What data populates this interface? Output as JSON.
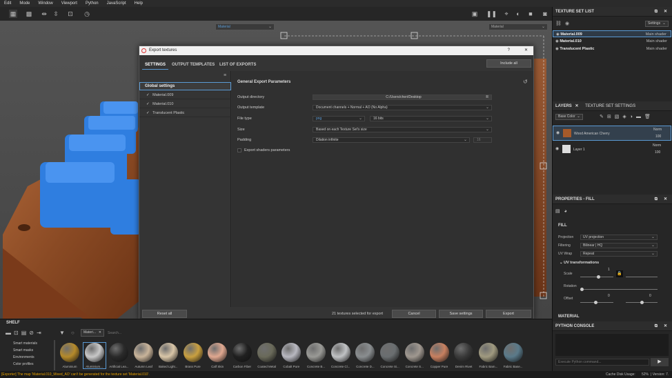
{
  "menu": [
    "Edit",
    "Mode",
    "Window",
    "Viewport",
    "Python",
    "JavaScript",
    "Help"
  ],
  "viewport": {
    "left_select": "Material",
    "right_select": "Material"
  },
  "dialog": {
    "title": "Export textures",
    "help": "?",
    "close": "✕",
    "tabs": [
      "SETTINGS",
      "OUTPUT TEMPLATES",
      "LIST OF EXPORTS"
    ],
    "include_all": "Include all",
    "global_settings": "Global settings",
    "texture_sets": [
      "Material.009",
      "Material.010",
      "Translucent Plastic"
    ],
    "section_title": "General Export Parameters",
    "rows": {
      "output_directory": {
        "label": "Output directory",
        "value": "C:/Users/cheri/Desktop",
        "suffix": "R"
      },
      "output_template": {
        "label": "Output template",
        "value": "Document channels + Normal + AO (No Alpha)"
      },
      "file_type": {
        "label": "File type",
        "value": "png",
        "bits": "16 bits"
      },
      "size": {
        "label": "Size",
        "value": "Based on each Texture Set's size"
      },
      "padding": {
        "label": "Padding",
        "value": "Dilation infinite",
        "extra": "16"
      }
    },
    "export_shaders": "Export shaders parameters",
    "reset_all": "Reset all",
    "footer_status": "21 textures selected for export",
    "cancel": "Cancel",
    "save_settings": "Save settings",
    "export": "Export"
  },
  "right": {
    "texture_set_list": {
      "title": "TEXTURE SET LIST",
      "settings": "Settings",
      "items": [
        {
          "name": "Material.009",
          "shader": "Main shader"
        },
        {
          "name": "Material.010",
          "shader": "Main shader"
        },
        {
          "name": "Translucent Plastic",
          "shader": "Main shader"
        }
      ]
    },
    "layers": {
      "tab1": "LAYERS",
      "tab2": "TEXTURE SET SETTINGS",
      "channel": "Base Color",
      "items": [
        {
          "name": "Wood American Cherry",
          "blend": "Norm",
          "opacity": "100"
        },
        {
          "name": "Layer 1",
          "blend": "Norm",
          "opacity": "100"
        }
      ]
    },
    "properties": {
      "title": "PROPERTIES - FILL",
      "fill": "FILL",
      "projection_label": "Projection",
      "projection": "UV projection",
      "filtering_label": "Filtering",
      "filtering": "Bilinear | HQ",
      "uvwrap_label": "UV Wrap",
      "uvwrap": "Repeat",
      "uv_transform": "UV transformations",
      "scale": "Scale",
      "scale_val": "1",
      "rotation": "Rotation",
      "offset": "Offset",
      "offset_x": "0",
      "offset_y": "0",
      "material": "MATERIAL"
    },
    "python": {
      "title": "PYTHON CONSOLE",
      "placeholder": "Execute Python command..."
    }
  },
  "shelf": {
    "title": "SHELF",
    "categories": [
      "Smart materials",
      "Smart masks",
      "Environments",
      "Color profiles"
    ],
    "filter_tag": "Materi...",
    "search_placeholder": "Search...",
    "materials": [
      {
        "name": "Aluminium",
        "color": "#b58a2a"
      },
      {
        "name": "Aluminium...",
        "color": "#c8c8c8"
      },
      {
        "name": "Artificial Lea...",
        "color": "#2a2a2a"
      },
      {
        "name": "Autumn Leaf",
        "color": "#c9b49a"
      },
      {
        "name": "Baked Light...",
        "color": "#d9c6a8"
      },
      {
        "name": "Brass Pure",
        "color": "#c9a040"
      },
      {
        "name": "Calf Skin",
        "color": "#e0a890"
      },
      {
        "name": "Carbon Fiber",
        "color": "#202020"
      },
      {
        "name": "Coated Metal",
        "color": "#6a6a5a"
      },
      {
        "name": "Cobalt Pure",
        "color": "#b8b8c0"
      },
      {
        "name": "Concrete B...",
        "color": "#9a9a96"
      },
      {
        "name": "Concrete Cl...",
        "color": "#c0c2c4"
      },
      {
        "name": "Concrete D...",
        "color": "#8a8e90"
      },
      {
        "name": "Concrete Si...",
        "color": "#6a6e70"
      },
      {
        "name": "Concrete S...",
        "color": "#a09890"
      },
      {
        "name": "Copper Pure",
        "color": "#c88060"
      },
      {
        "name": "Denim Rivet",
        "color": "#3a3a3a"
      },
      {
        "name": "Fabric Bam...",
        "color": "#a09a80"
      },
      {
        "name": "Fabric Base...",
        "color": "#5a7a8a"
      }
    ]
  },
  "status": {
    "message": "[Exporter] The map 'Material.010_Mixed_AO' can't be generated for the texture set 'Material.010'.",
    "cache": "Cache Disk Usage:",
    "cache_val": "52%",
    "version": "| Version: 7."
  }
}
